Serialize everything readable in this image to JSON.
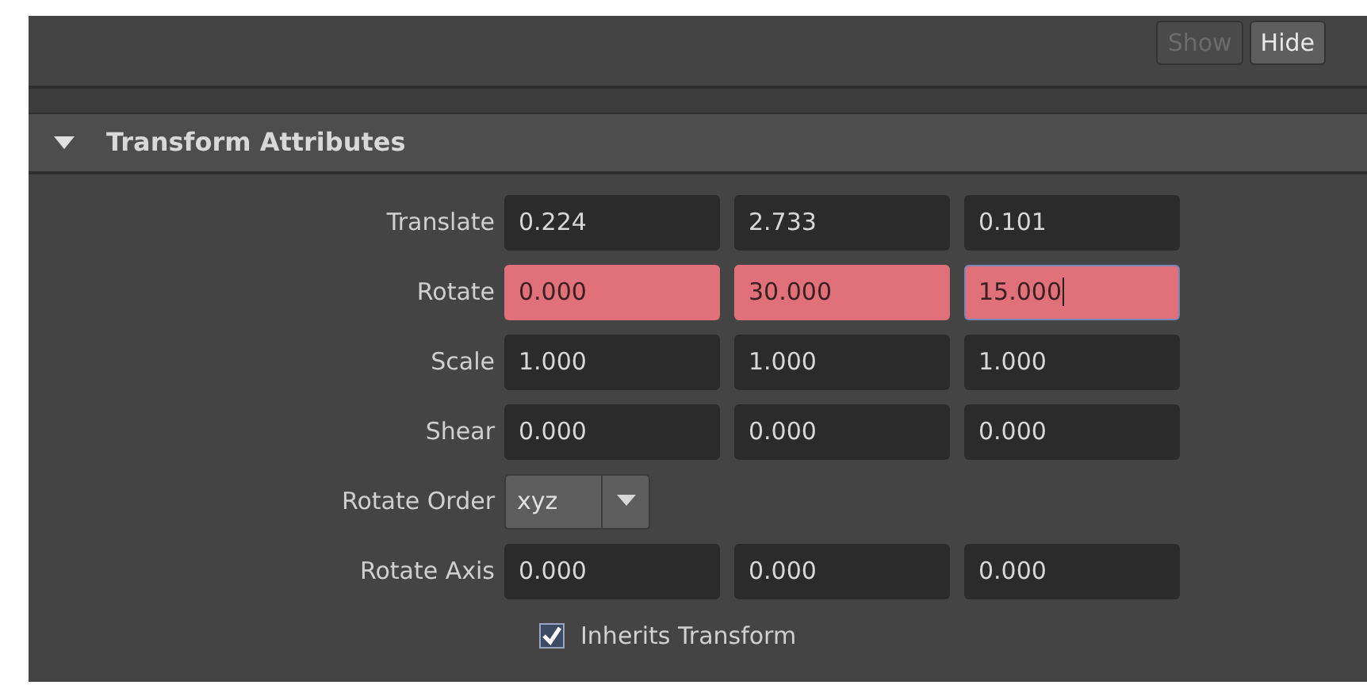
{
  "buttons": [
    {
      "label": "Show",
      "disabled": true
    },
    {
      "label": "Hide",
      "disabled": false
    }
  ],
  "section": {
    "title": "Transform Attributes",
    "expanded": true,
    "rows": [
      {
        "kind": "vector",
        "label": "Translate",
        "fields": [
          {
            "value": "0.224",
            "keyed": false,
            "focused": false
          },
          {
            "value": "2.733",
            "keyed": false,
            "focused": false
          },
          {
            "value": "0.101",
            "keyed": false,
            "focused": false
          }
        ]
      },
      {
        "kind": "vector",
        "label": "Rotate",
        "fields": [
          {
            "value": "0.000",
            "keyed": true,
            "focused": false
          },
          {
            "value": "30.000",
            "keyed": true,
            "focused": false
          },
          {
            "value": "15.000",
            "keyed": true,
            "focused": true
          }
        ]
      },
      {
        "kind": "vector",
        "label": "Scale",
        "fields": [
          {
            "value": "1.000",
            "keyed": false,
            "focused": false
          },
          {
            "value": "1.000",
            "keyed": false,
            "focused": false
          },
          {
            "value": "1.000",
            "keyed": false,
            "focused": false
          }
        ]
      },
      {
        "kind": "vector",
        "label": "Shear",
        "fields": [
          {
            "value": "0.000",
            "keyed": false,
            "focused": false
          },
          {
            "value": "0.000",
            "keyed": false,
            "focused": false
          },
          {
            "value": "0.000",
            "keyed": false,
            "focused": false
          }
        ]
      },
      {
        "kind": "dropdown",
        "label": "Rotate Order",
        "value": "xyz"
      },
      {
        "kind": "vector",
        "label": "Rotate Axis",
        "fields": [
          {
            "value": "0.000",
            "keyed": false,
            "focused": false
          },
          {
            "value": "0.000",
            "keyed": false,
            "focused": false
          },
          {
            "value": "0.000",
            "keyed": false,
            "focused": false
          }
        ]
      },
      {
        "kind": "checkbox",
        "label": "Inherits Transform",
        "checked": true
      }
    ]
  }
}
